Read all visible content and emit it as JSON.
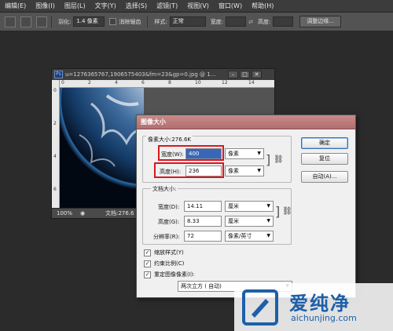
{
  "menubar": {
    "items": [
      "编辑(E)",
      "图像(I)",
      "图层(L)",
      "文字(Y)",
      "选择(S)",
      "滤镜(T)",
      "视图(V)",
      "窗口(W)",
      "帮助(H)"
    ]
  },
  "optbar": {
    "feather_label": "羽化:",
    "feather_value": "1.4 像素",
    "antialias_label": "消除锯齿",
    "style_label": "样式:",
    "style_value": "正常",
    "width_label": "宽度:",
    "height_label": "高度:",
    "refine_edge_button": "调整边缘..."
  },
  "document": {
    "title": "u=1276365767,1906575403&fm=23&gp=0.jpg @ 1...",
    "ps_badge": "Ps",
    "zoom": "100%",
    "status": "文档:276.6",
    "ruler_h": [
      "0",
      "2",
      "4",
      "6",
      "8",
      "10",
      "12",
      "14"
    ],
    "ruler_v": [
      "0",
      "2",
      "4",
      "6"
    ]
  },
  "dialog": {
    "title": "图像大小",
    "pixel_dimensions_label": "像素大小:276.6K",
    "width_label": "宽度(W):",
    "width_value": "400",
    "width_unit": "像素",
    "height_label": "高度(H):",
    "height_value": "236",
    "height_unit": "像素",
    "document_size_label": "文档大小:",
    "doc_width_label": "宽度(D):",
    "doc_width_value": "14.11",
    "doc_width_unit": "厘米",
    "doc_height_label": "高度(G):",
    "doc_height_value": "8.33",
    "doc_height_unit": "厘米",
    "resolution_label": "分辨率(R):",
    "resolution_value": "72",
    "resolution_unit": "像素/英寸",
    "scale_styles_label": "缩放样式(Y)",
    "constrain_label": "约束比例(C)",
    "resample_label": "重定图像像素(I):",
    "resample_method": "两次立方 ( 自动)",
    "ok_button": "确定",
    "reset_button": "复位",
    "auto_button": "自动(A)..."
  },
  "watermark": {
    "cn": "爱纯净",
    "en": "aichunjing.com"
  },
  "colors": {
    "highlight_red": "#d7181e",
    "dialog_title_bg": "#b16f6f",
    "brand_blue": "#1d5fa8"
  }
}
